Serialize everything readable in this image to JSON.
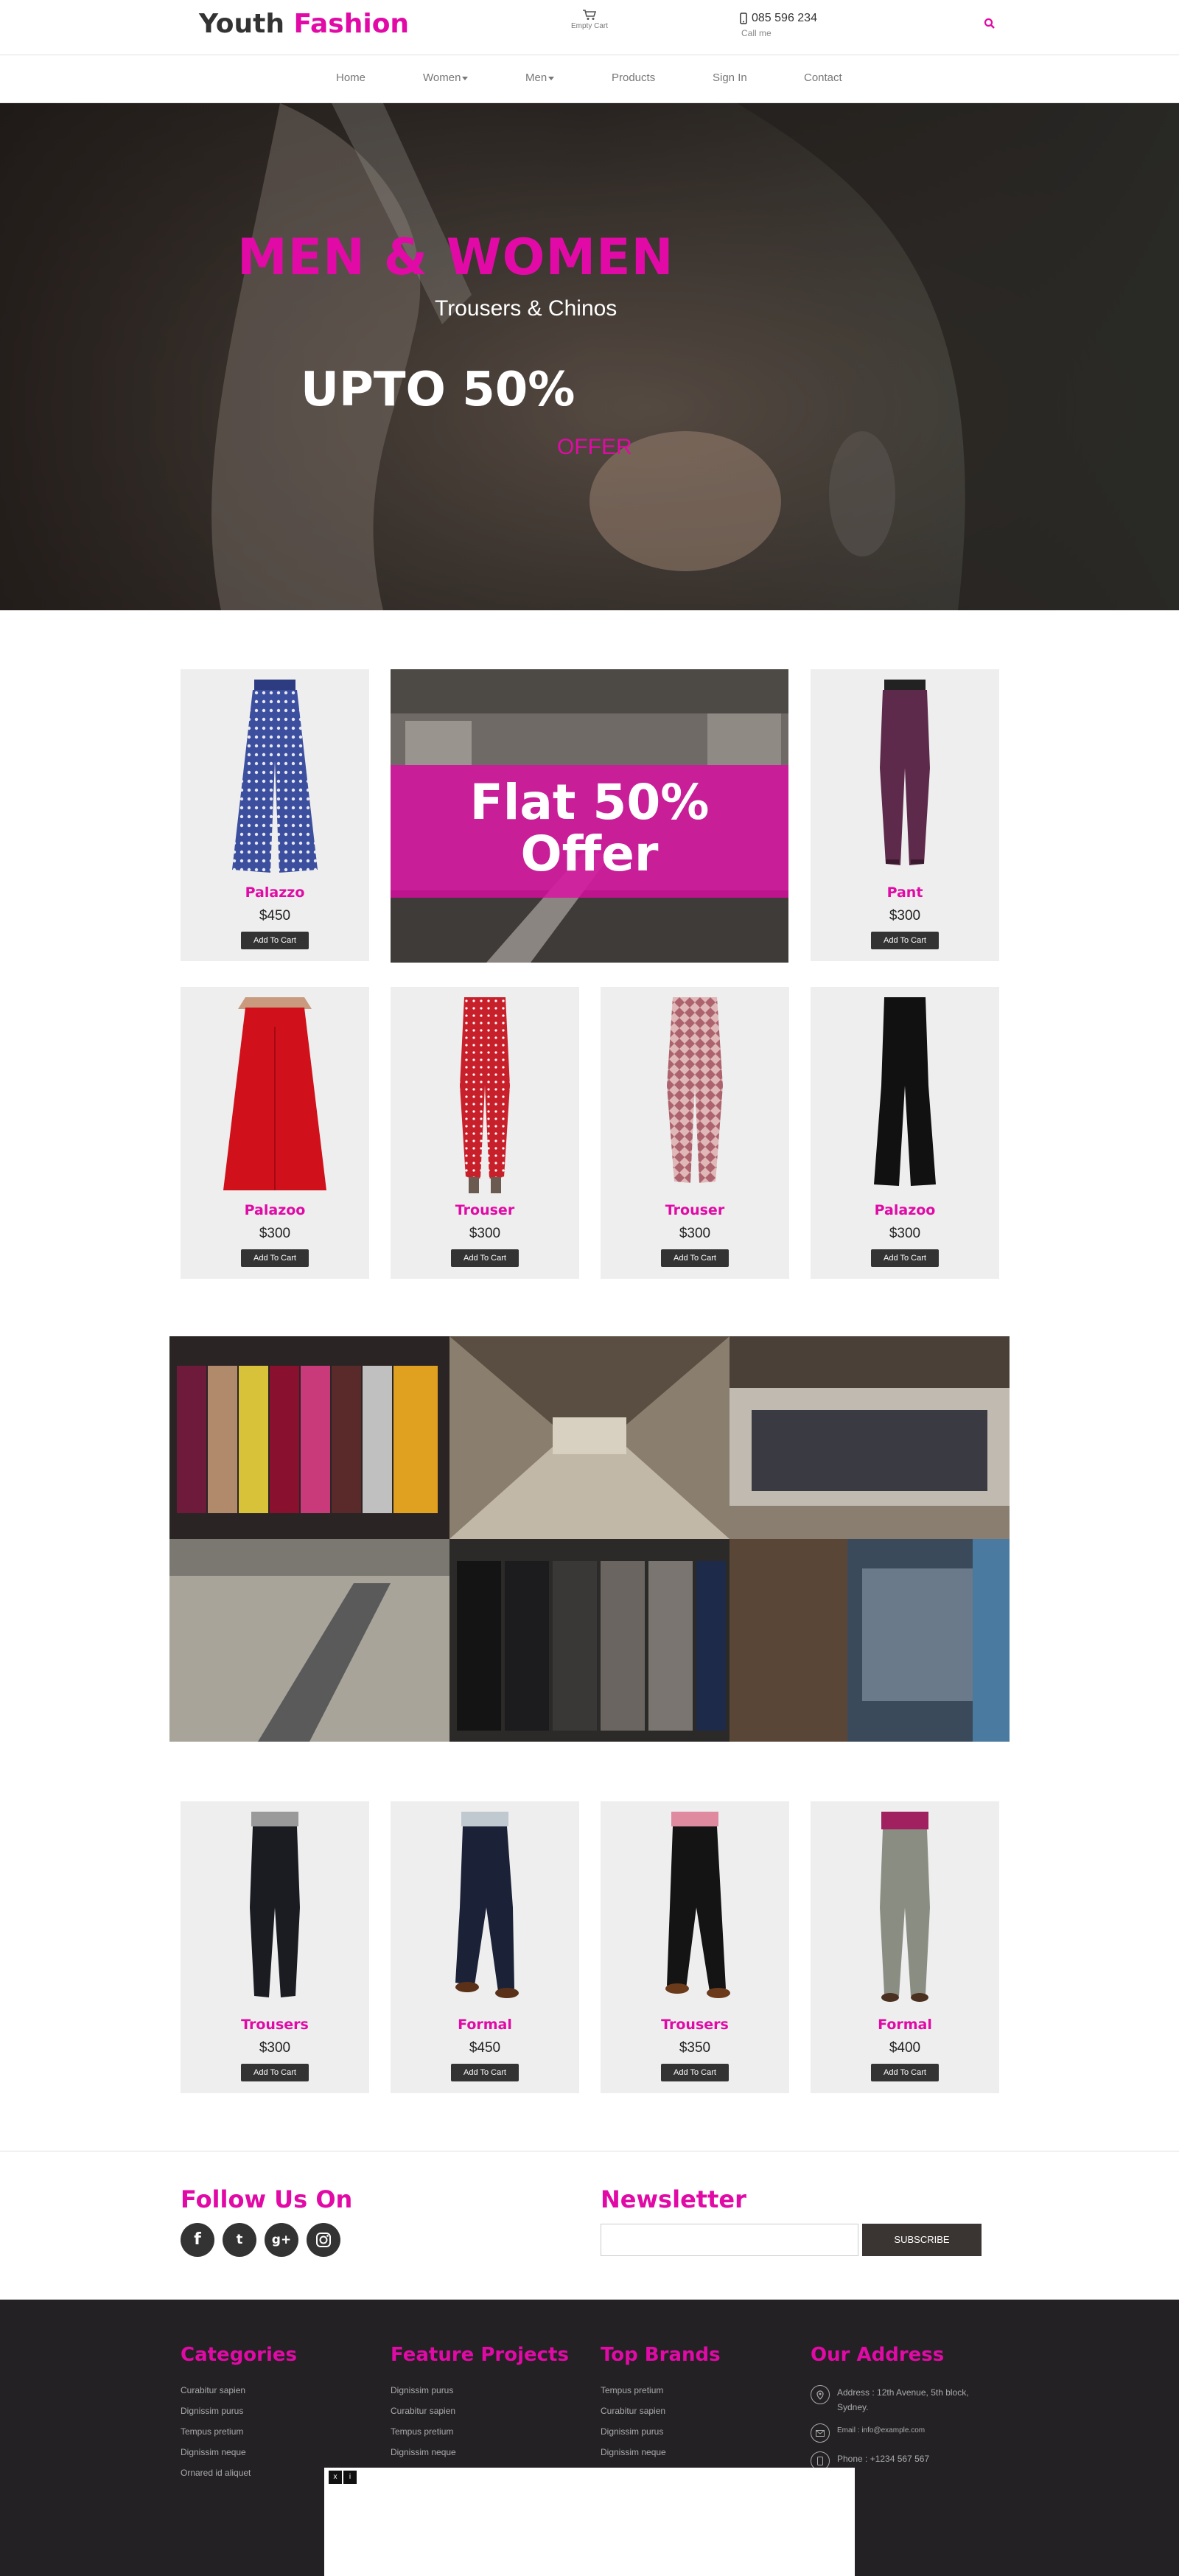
{
  "header": {
    "brand_main": "Youth",
    "brand_accent": "Fashion",
    "cart_label": "Empty Cart",
    "phone": "085 596 234",
    "phone_sub": "Call me",
    "nav": [
      {
        "label": "Home"
      },
      {
        "label": "Women",
        "dropdown": true
      },
      {
        "label": "Men",
        "dropdown": true
      },
      {
        "label": "Products"
      },
      {
        "label": "Sign In"
      },
      {
        "label": "Contact"
      }
    ]
  },
  "hero": {
    "headline": "MEN & WOMEN",
    "subheadline": "Trousers & Chinos",
    "discount": "UPTO 50%",
    "offer": "OFFER"
  },
  "promo": {
    "line1": "Flat 50%",
    "line2": "Offer"
  },
  "products_row1": [
    {
      "name": "Palazzo",
      "price": "$450",
      "button": "Add To Cart",
      "icon": "blue-print-palazzo"
    },
    {
      "name": "Pant",
      "price": "$300",
      "button": "Add To Cart",
      "icon": "purple-pant"
    }
  ],
  "products_row2": [
    {
      "name": "Palazoo",
      "price": "$300",
      "button": "Add To Cart",
      "icon": "red-palazzo"
    },
    {
      "name": "Trouser",
      "price": "$300",
      "button": "Add To Cart",
      "icon": "red-dotted-trouser"
    },
    {
      "name": "Trouser",
      "price": "$300",
      "button": "Add To Cart",
      "icon": "printed-trouser"
    },
    {
      "name": "Palazoo",
      "price": "$300",
      "button": "Add To Cart",
      "icon": "black-palazzo"
    }
  ],
  "products_row3": [
    {
      "name": "Trousers",
      "price": "$300",
      "button": "Add To Cart",
      "icon": "black-trousers"
    },
    {
      "name": "Formal",
      "price": "$450",
      "button": "Add To Cart",
      "icon": "navy-formal"
    },
    {
      "name": "Trousers",
      "price": "$350",
      "button": "Add To Cart",
      "icon": "black-trousers"
    },
    {
      "name": "Formal",
      "price": "$400",
      "button": "Add To Cart",
      "icon": "grey-formal"
    }
  ],
  "social": {
    "heading": "Follow Us On",
    "icons": [
      "facebook-icon",
      "twitter-icon",
      "google-plus-icon",
      "instagram-icon"
    ]
  },
  "newsletter": {
    "heading": "Newsletter",
    "input_placeholder": "",
    "button": "SUBSCRIBE"
  },
  "footer": {
    "categories": {
      "heading": "Categories",
      "links": [
        "Curabitur sapien",
        "Dignissim purus",
        "Tempus pretium",
        "Dignissim neque",
        "Ornared id aliquet"
      ]
    },
    "feature_projects": {
      "heading": "Feature Projects",
      "links": [
        "Dignissim purus",
        "Curabitur sapien",
        "Tempus pretium",
        "Dignissim neque"
      ]
    },
    "top_brands": {
      "heading": "Top Brands",
      "links": [
        "Tempus pretium",
        "Curabitur sapien",
        "Dignissim purus",
        "Dignissim neque"
      ]
    },
    "address": {
      "heading": "Our Address",
      "address": "Address : 12th Avenue, 5th block, Sydney.",
      "email": "Email : info@example.com",
      "phone": "Phone : +1234 567 567"
    }
  },
  "overlay": {
    "close_label": "x",
    "info_label": "i"
  },
  "colors": {
    "accent": "#e10aa6",
    "dark": "#232124",
    "card_bg": "#eeeeee"
  }
}
